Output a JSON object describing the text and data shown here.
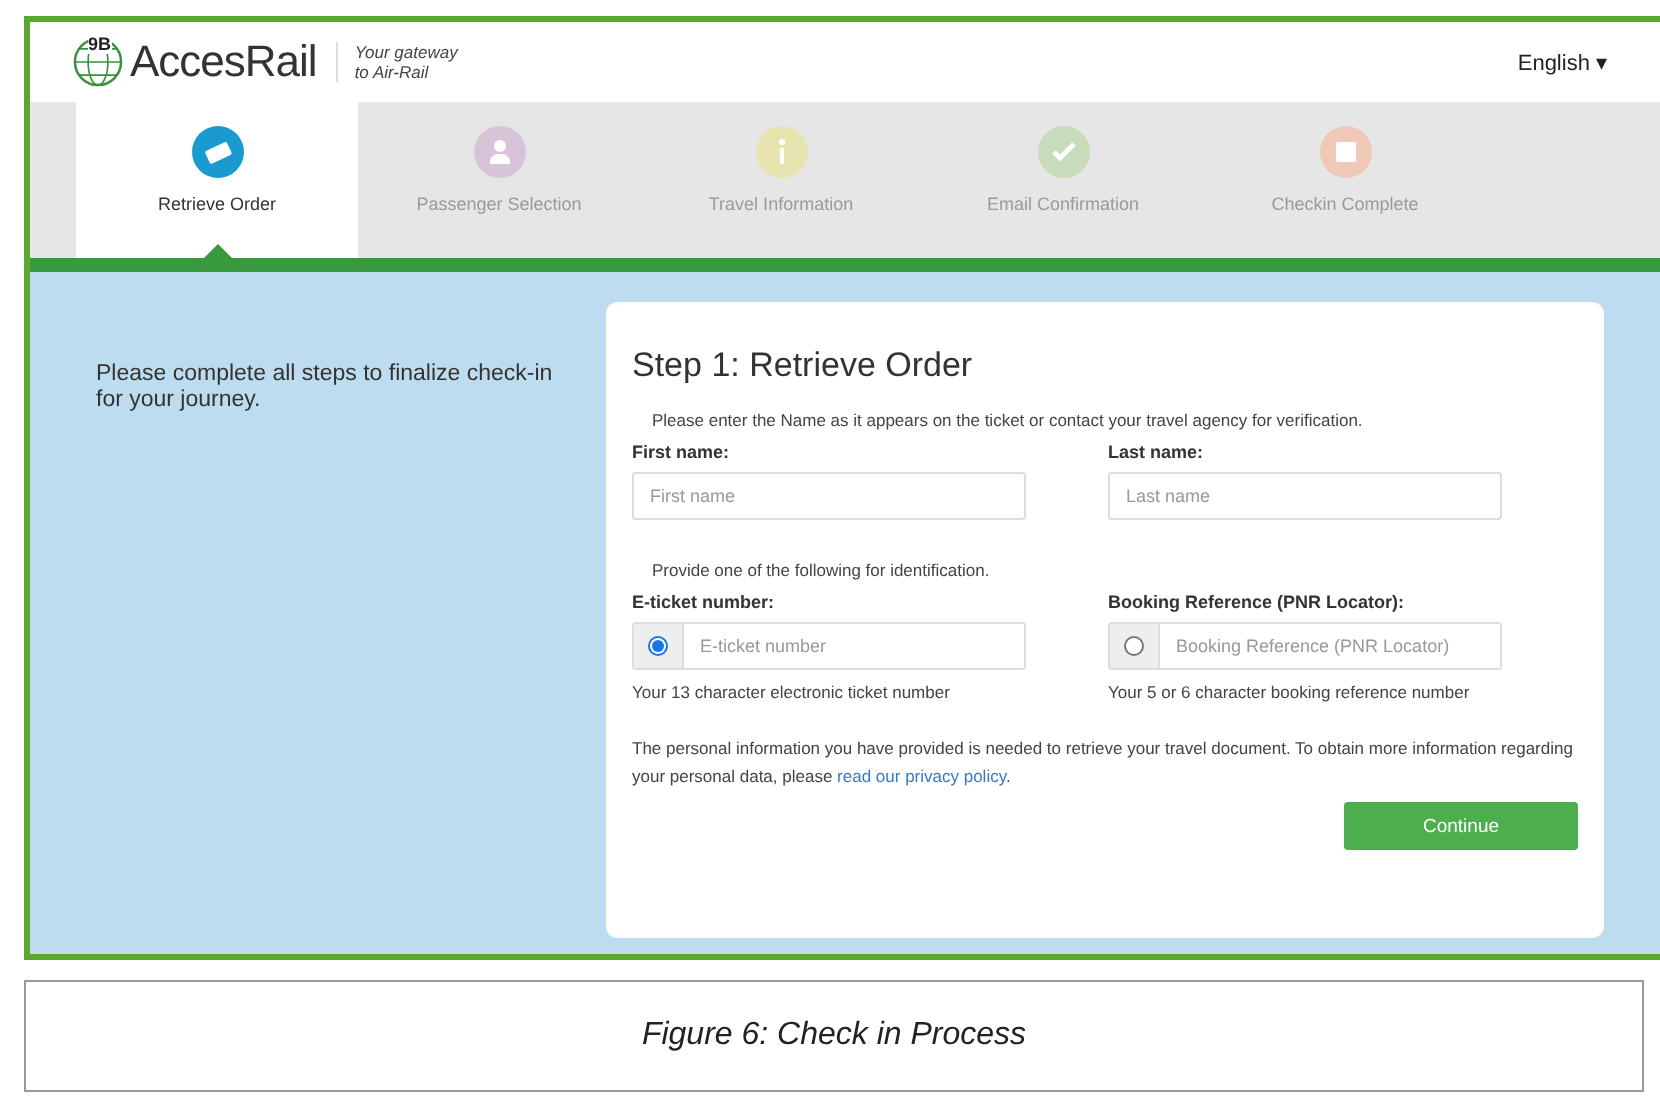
{
  "header": {
    "logo_mark": "9B",
    "logo_text": "AccesRail",
    "tagline": [
      "Your gateway",
      "to Air-Rail"
    ],
    "language": "English",
    "language_caret": "▾"
  },
  "steps": [
    {
      "label": "Retrieve Order",
      "selected": true,
      "color": "#1a9bd0"
    },
    {
      "label": "Passenger Selection",
      "selected": false,
      "color": "#d8c4d8"
    },
    {
      "label": "Travel Information",
      "selected": false,
      "color": "#e8e4b0"
    },
    {
      "label": "Email Confirmation",
      "selected": false,
      "color": "#c8dcbc"
    },
    {
      "label": "Checkin Complete",
      "selected": false,
      "color": "#f0c8b8"
    }
  ],
  "intro": "Please complete all steps to finalize check-in for your journey.",
  "form": {
    "title": "Step 1: Retrieve Order",
    "instruction": "Please enter the Name as it appears on the ticket or contact your travel agency for verification.",
    "name_fields": [
      {
        "label": "First name:",
        "placeholder": "First name"
      },
      {
        "label": "Last name:",
        "placeholder": "Last name"
      }
    ],
    "id_instruction": "Provide one of the following for identification.",
    "id_fields": [
      {
        "label": "E-ticket number:",
        "placeholder": "E-ticket number",
        "selected": true,
        "help": "Your 13 character electronic ticket number"
      },
      {
        "label": "Booking Reference (PNR Locator):",
        "placeholder": "Booking Reference (PNR Locator)",
        "selected": false,
        "help": "Your 5 or 6 character booking reference number"
      }
    ],
    "privacy": "The personal information you have provided is needed to retrieve your travel document. To obtain more information regarding your personal data, please ",
    "privacy_link": "read our privacy policy",
    "privacy_end": ".",
    "button": "Continue"
  },
  "caption": "Figure 6: Check in Process"
}
